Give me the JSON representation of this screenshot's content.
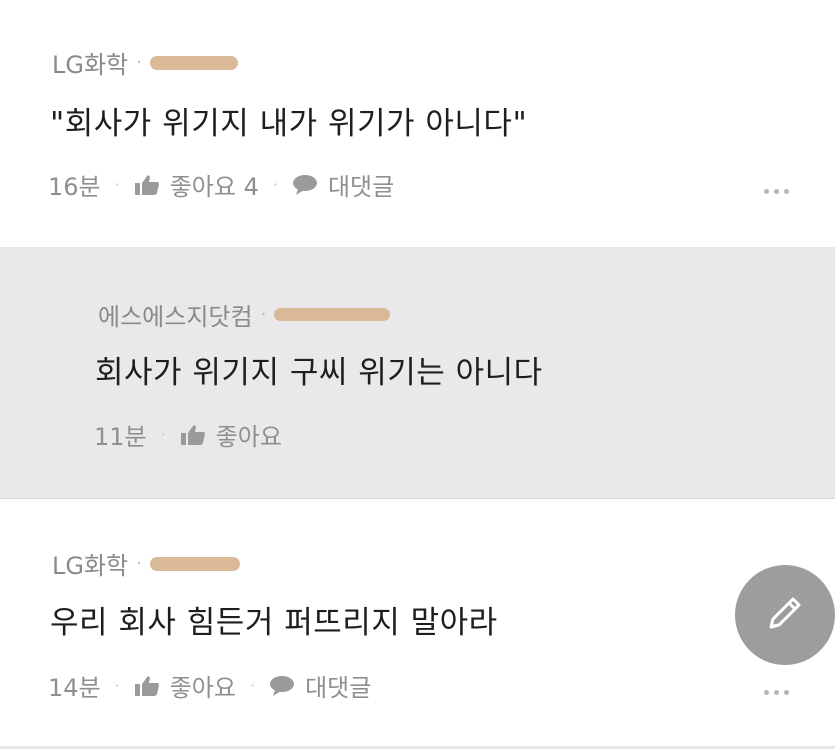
{
  "comments": [
    {
      "author": "LG화학",
      "text": "\"회사가 위기지 내가 위기가 아니다\"",
      "time": "16분",
      "like_label": "좋아요 4",
      "reply_label": "대댓글"
    },
    {
      "author": "에스에스지닷컴",
      "text": "회사가 위기지 구씨 위기는 아니다",
      "time": "11분",
      "like_label": "좋아요"
    },
    {
      "author": "LG화학",
      "text": "우리 회사 힘든거 퍼뜨리지 말아라",
      "time": "14분",
      "like_label": "좋아요",
      "reply_label": "대댓글"
    }
  ],
  "icons": {
    "like": "thumbs-up-icon",
    "reply": "speech-bubble-icon",
    "more": "more-dots-icon",
    "write": "pencil-icon"
  },
  "colors": {
    "reply_background": "#e9e9eb",
    "fab": "#9d9d9f",
    "redaction": "#d8b693"
  }
}
